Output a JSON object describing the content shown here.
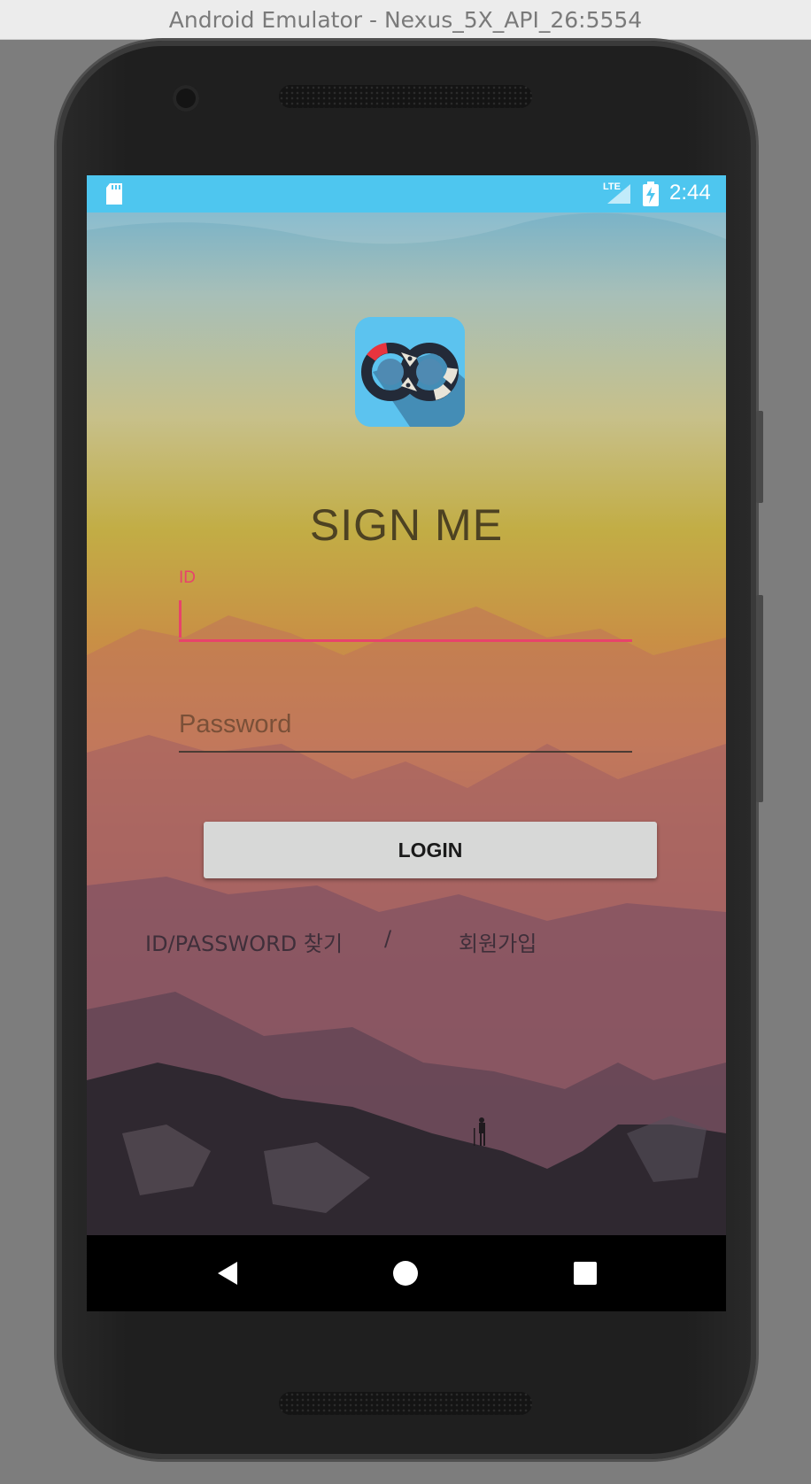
{
  "window": {
    "title": "Android Emulator - Nexus_5X_API_26:5554"
  },
  "status_bar": {
    "network": "LTE",
    "time": "2:44",
    "color": "#4ec6ef"
  },
  "login_screen": {
    "title": "SIGN ME",
    "id_field": {
      "label": "ID",
      "value": ""
    },
    "password_field": {
      "placeholder": "Password",
      "value": ""
    },
    "login_button": "LOGIN",
    "find_link": "ID/PASSWORD 찾기",
    "separator": "/",
    "signup_link": "회원가입",
    "accent_color": "#e8436b"
  },
  "nav_bar": {
    "buttons": [
      "back-icon",
      "home-icon",
      "recents-icon"
    ]
  }
}
